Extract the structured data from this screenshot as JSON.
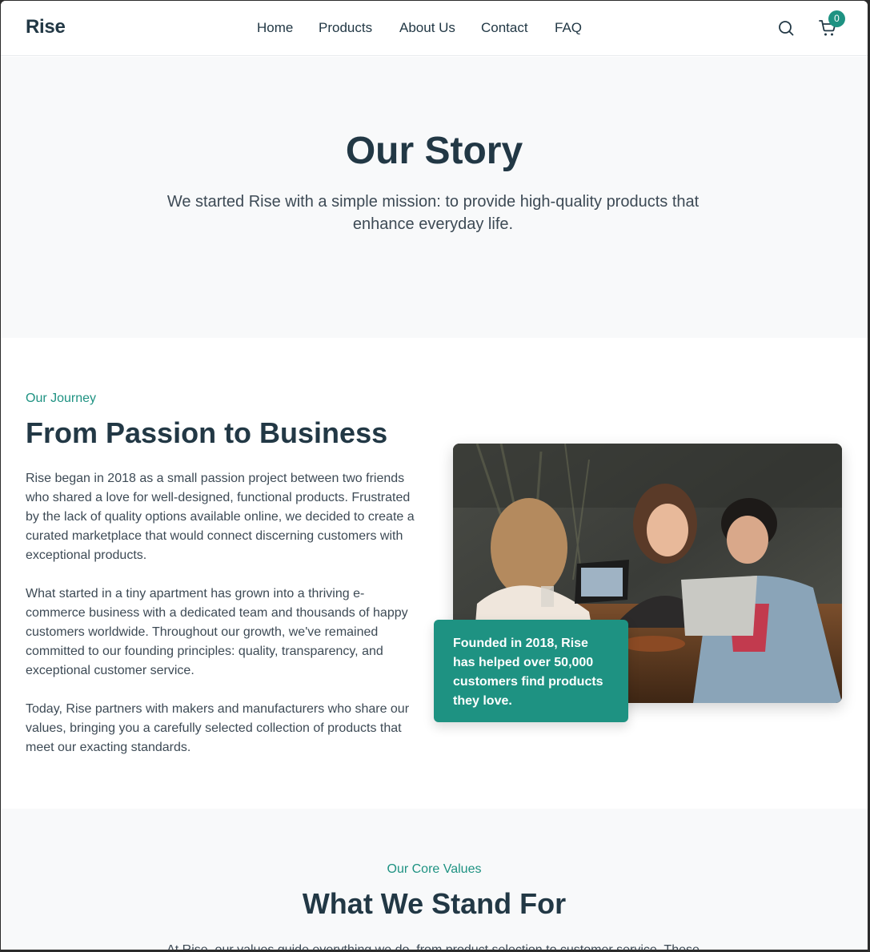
{
  "header": {
    "logo": "Rise",
    "nav": [
      "Home",
      "Products",
      "About Us",
      "Contact",
      "FAQ"
    ],
    "cart_count": "0"
  },
  "hero": {
    "title": "Our Story",
    "subtitle": "We started Rise with a simple mission: to provide high-quality products that enhance everyday life."
  },
  "journey": {
    "eyebrow": "Our Journey",
    "title": "From Passion to Business",
    "paragraphs": [
      "Rise began in 2018 as a small passion project between two friends who shared a love for well-designed, functional products. Frustrated by the lack of quality options available online, we decided to create a curated marketplace that would connect discerning customers with exceptional products.",
      "What started in a tiny apartment has grown into a thriving e-commerce business with a dedicated team and thousands of happy customers worldwide. Throughout our growth, we've remained committed to our founding principles: quality, transparency, and exceptional customer service.",
      "Today, Rise partners with makers and manufacturers who share our values, bringing you a carefully selected collection of products that meet our exacting standards."
    ],
    "callout": "Founded in 2018, Rise has helped over 50,000 customers find products they love."
  },
  "values": {
    "eyebrow": "Our Core Values",
    "title": "What We Stand For",
    "subtitle": "At Rise, our values guide everything we do, from product selection to customer service. These"
  }
}
